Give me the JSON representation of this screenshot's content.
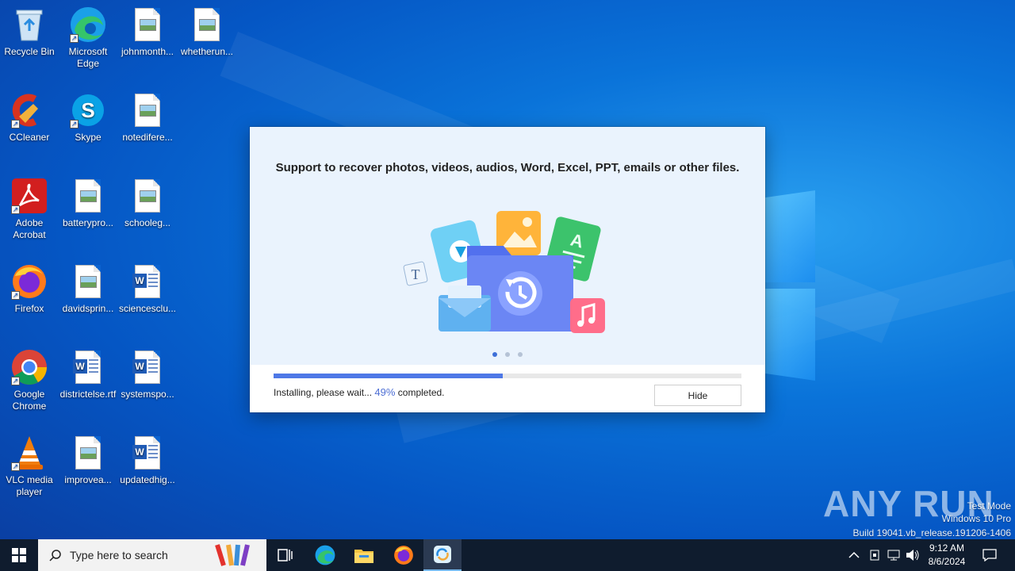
{
  "desktop": {
    "icons": [
      {
        "label": "Recycle Bin",
        "icon": "recycle-bin-icon"
      },
      {
        "label": "Microsoft Edge",
        "icon": "edge-icon"
      },
      {
        "label": "johnmonth...",
        "icon": "image-file-icon"
      },
      {
        "label": "whetherun...",
        "icon": "image-file-icon"
      },
      {
        "label": "CCleaner",
        "icon": "ccleaner-icon"
      },
      {
        "label": "Skype",
        "icon": "skype-icon"
      },
      {
        "label": "notedifere...",
        "icon": "image-file-icon"
      },
      {
        "label": "Adobe Acrobat",
        "icon": "acrobat-icon"
      },
      {
        "label": "batterypro...",
        "icon": "image-file-icon"
      },
      {
        "label": "schooleg...",
        "icon": "image-file-icon"
      },
      {
        "label": "Firefox",
        "icon": "firefox-icon"
      },
      {
        "label": "davidsprin...",
        "icon": "image-file-icon"
      },
      {
        "label": "sciencesclu...",
        "icon": "word-doc-icon"
      },
      {
        "label": "Google Chrome",
        "icon": "chrome-icon"
      },
      {
        "label": "districtelse.rtf",
        "icon": "word-doc-icon"
      },
      {
        "label": "systemspo...",
        "icon": "word-doc-icon"
      },
      {
        "label": "VLC media player",
        "icon": "vlc-icon"
      },
      {
        "label": "improvea...",
        "icon": "image-file-icon"
      },
      {
        "label": "updatedhig...",
        "icon": "word-doc-icon"
      }
    ]
  },
  "installer": {
    "headline": "Support to recover photos, videos, audios, Word, Excel, PPT, emails or other files.",
    "progress_percent": 49,
    "status_prefix": "Installing, please wait...",
    "status_percent": "49%",
    "status_suffix": "completed.",
    "carousel_pages": 3,
    "carousel_active": 1,
    "hide_label": "Hide"
  },
  "watermark": {
    "brand": "ANY RUN",
    "mode": "Test Mode",
    "edition": "Windows 10 Pro",
    "build": "Build 19041.vb_release.191206-1406"
  },
  "taskbar": {
    "search_placeholder": "Type here to search",
    "apps": [
      "task-view-icon",
      "edge-icon",
      "file-explorer-icon",
      "firefox-icon",
      "installer-app-icon"
    ],
    "clock_time": "9:12 AM",
    "clock_date": "8/6/2024"
  },
  "colors": {
    "accent": "#4e78e6",
    "taskbar": "#0f1c2e",
    "dialog_hero": "#eaf3fd"
  }
}
